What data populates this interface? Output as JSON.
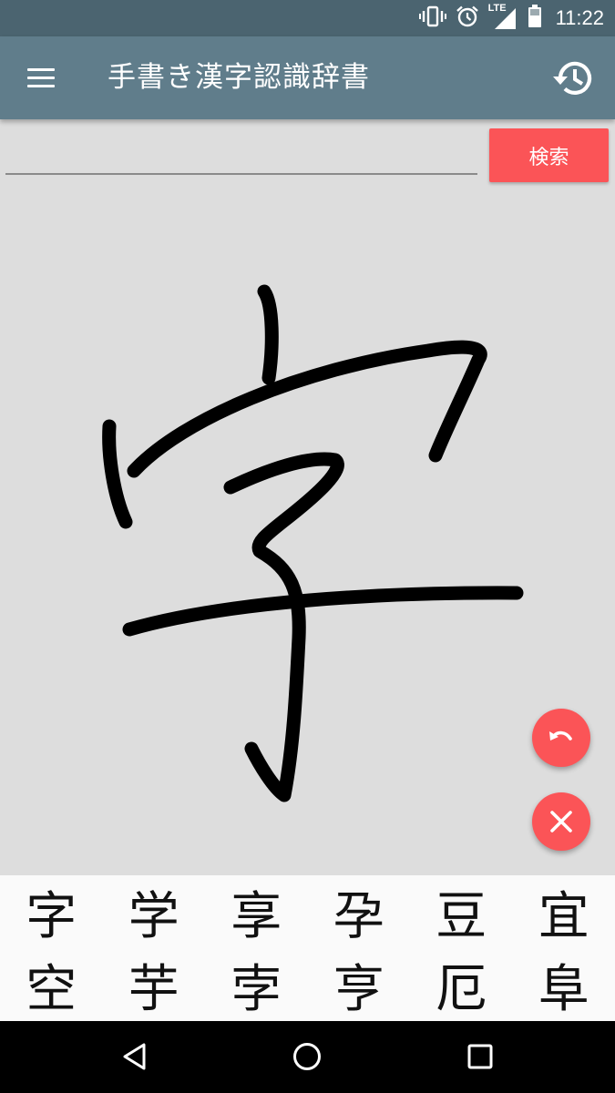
{
  "status_bar": {
    "time": "11:22",
    "network_label": "LTE",
    "icons": [
      "vibrate-icon",
      "alarm-icon",
      "signal-icon",
      "battery-icon"
    ]
  },
  "app_bar": {
    "title": "手書き漢字認識辞書",
    "menu_icon": "menu-icon",
    "history_icon": "history-icon"
  },
  "search": {
    "value": "",
    "placeholder": "",
    "button_label": "検索"
  },
  "drawing": {
    "stroke_color": "#000000",
    "background": "#dddddd"
  },
  "fabs": {
    "undo_icon": "undo-icon",
    "clear_icon": "close-icon",
    "color": "#fb5457"
  },
  "candidates": [
    "字",
    "学",
    "享",
    "孕",
    "豆",
    "宜",
    "空",
    "芋",
    "孛",
    "亨",
    "厄",
    "阜"
  ],
  "nav_bar": {
    "icons": [
      "back-icon",
      "home-icon",
      "recents-icon"
    ]
  },
  "colors": {
    "status_bar": "#4b6470",
    "app_bar": "#607d8b",
    "accent": "#fb5457"
  }
}
